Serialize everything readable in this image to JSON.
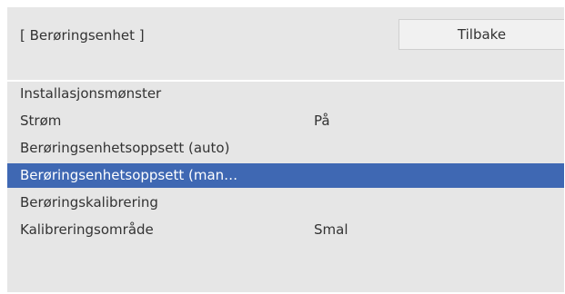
{
  "header": {
    "title": "[ Berøringsenhet ]",
    "back_label": "Tilbake"
  },
  "menu": {
    "selected_index": 3,
    "items": [
      {
        "label": "Installasjonsmønster",
        "value": ""
      },
      {
        "label": "Strøm",
        "value": "På"
      },
      {
        "label": "Berøringsenhetsoppsett (auto)",
        "value": ""
      },
      {
        "label": "Berøringsenhetsoppsett (man…",
        "value": ""
      },
      {
        "label": "Berøringskalibrering",
        "value": ""
      },
      {
        "label": "Kalibreringsområde",
        "value": "Smal"
      }
    ]
  },
  "colors": {
    "selection": "#3f68b3",
    "panel": "#e6e6e6"
  }
}
